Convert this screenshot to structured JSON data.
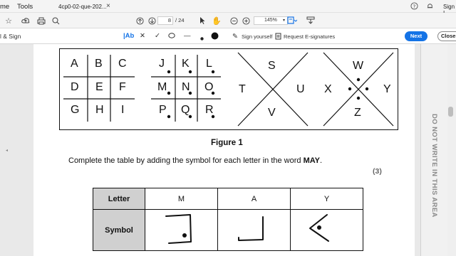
{
  "menubar": {
    "home_tab": "me",
    "tools_tab": "Tools",
    "doc_tab": "4cp0-02-que-202...",
    "close_symbol": "×",
    "sign_in": "Sign I"
  },
  "toolbar": {
    "page_current": "8",
    "page_total": "/ 24",
    "zoom": "145%"
  },
  "fill_sign": {
    "title": "l & Sign",
    "text_tool": "|Ab",
    "sign_yourself": "Sign yourself",
    "request_esign": "Request E-signatures",
    "next_label": "Next",
    "close_label": "Close"
  },
  "sidebar": {
    "caption": "DO NOT WRITE IN THIS AREA"
  },
  "figure": {
    "grid1": [
      "A",
      "B",
      "C",
      "D",
      "E",
      "F",
      "G",
      "H",
      "I"
    ],
    "grid2": [
      "J",
      "K",
      "L",
      "M",
      "N",
      "O",
      "P",
      "Q",
      "R"
    ],
    "x1": [
      "S",
      "T",
      "U",
      "V"
    ],
    "x2": [
      "W",
      "X",
      "Y",
      "Z"
    ],
    "caption": "Figure 1"
  },
  "question": {
    "text_before": "Complete the table by adding the symbol for each letter in the word ",
    "word": "MAY",
    "text_after": ".",
    "marks": "(3)"
  },
  "answer_table": {
    "letter_header": "Letter",
    "symbol_header": "Symbol",
    "letters": [
      "M",
      "A",
      "Y"
    ]
  }
}
